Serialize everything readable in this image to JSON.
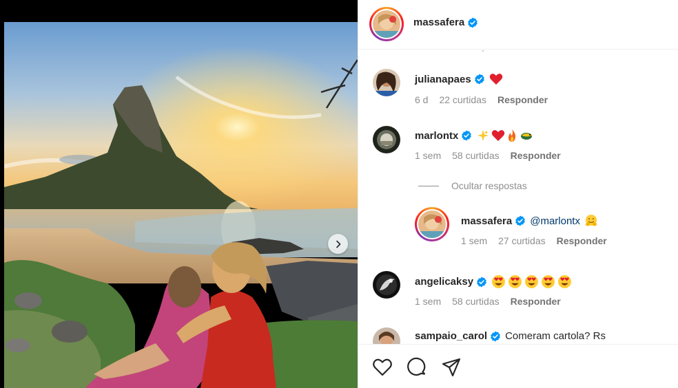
{
  "post": {
    "author": "massafera",
    "author_verified": true
  },
  "comments": [
    {
      "user": "julianapaes",
      "verified": true,
      "text": "",
      "emoji": [
        "red-heart"
      ],
      "time": "6 d",
      "likes": "22 curtidas",
      "reply_label": "Responder"
    },
    {
      "user": "marlontx",
      "verified": true,
      "text": "",
      "emoji": [
        "sparkle-star",
        "red-heart",
        "fire",
        "bird"
      ],
      "time": "1 sem",
      "likes": "58 curtidas",
      "reply_label": "Responder"
    },
    {
      "user": "angelicaksy",
      "verified": true,
      "text": "",
      "emoji": [
        "heart-eyes",
        "heart-eyes",
        "heart-eyes",
        "heart-eyes",
        "heart-eyes"
      ],
      "time": "1 sem",
      "likes": "58 curtidas",
      "reply_label": "Responder"
    },
    {
      "user": "sampaio_carol",
      "verified": true,
      "text": "Comeram cartola? Rs"
    }
  ],
  "hide_replies_label": "Ocultar respostas",
  "reply": {
    "user": "massafera",
    "verified": true,
    "mention": "@marlontx",
    "emoji": [
      "hugging-face"
    ],
    "time": "1 sem",
    "likes": "27 curtidas",
    "reply_label": "Responder"
  },
  "actions": {
    "like_icon": "heart-outline-icon",
    "comment_icon": "comment-bubble-icon",
    "share_icon": "paper-plane-icon"
  },
  "colors": {
    "verified": "#0095f6",
    "heart": "#ed4956",
    "mention": "#00376b",
    "meta": "#8e8e8e"
  }
}
